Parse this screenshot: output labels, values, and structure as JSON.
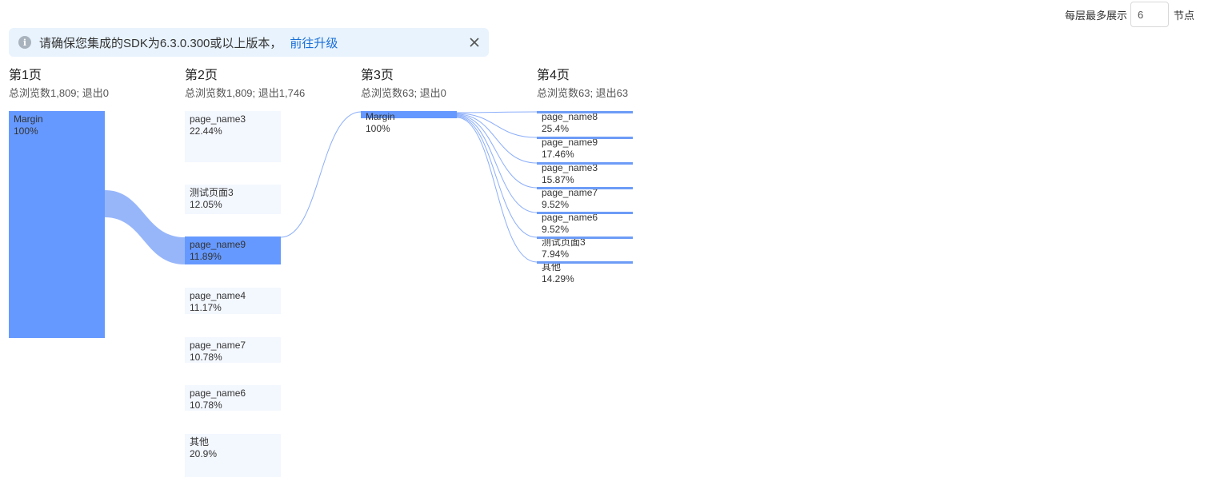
{
  "controls": {
    "max_nodes_label": "每层最多展示",
    "max_nodes_value": "6",
    "max_nodes_unit": "节点"
  },
  "notice": {
    "icon": "info-icon",
    "text": "请确保您集成的SDK为6.3.0.300或以上版本，",
    "link": "前往升级",
    "close_icon": "close-icon"
  },
  "columns": [
    {
      "title": "第1页",
      "summary": "总浏览数1,809; 退出0"
    },
    {
      "title": "第2页",
      "summary": "总浏览数1,809; 退出1,746"
    },
    {
      "title": "第3页",
      "summary": "总浏览数63; 退出0"
    },
    {
      "title": "第4页",
      "summary": "总浏览数63; 退出63"
    }
  ],
  "nodes": {
    "col1": [
      {
        "name": "Margin",
        "pct": "100%"
      }
    ],
    "col2": [
      {
        "name": "page_name3",
        "pct": "22.44%"
      },
      {
        "name": "测试页面3",
        "pct": "12.05%"
      },
      {
        "name": "page_name9",
        "pct": "11.89%"
      },
      {
        "name": "page_name4",
        "pct": "11.17%"
      },
      {
        "name": "page_name7",
        "pct": "10.78%"
      },
      {
        "name": "page_name6",
        "pct": "10.78%"
      },
      {
        "name": "其他",
        "pct": "20.9%"
      }
    ],
    "col3": [
      {
        "name": "Margin",
        "pct": "100%"
      }
    ],
    "col4": [
      {
        "name": "page_name8",
        "pct": "25.4%"
      },
      {
        "name": "page_name9",
        "pct": "17.46%"
      },
      {
        "name": "page_name3",
        "pct": "15.87%"
      },
      {
        "name": "page_name7",
        "pct": "9.52%"
      },
      {
        "name": "page_name6",
        "pct": "9.52%"
      },
      {
        "name": "测试页面3",
        "pct": "7.94%"
      },
      {
        "name": "其他",
        "pct": "14.29%"
      }
    ]
  },
  "colors": {
    "strong": "#6699ff",
    "light": "#f3f7fe",
    "flow": "#8caefa",
    "link": "#1a6fd6",
    "banner": "#e8f3fd"
  }
}
